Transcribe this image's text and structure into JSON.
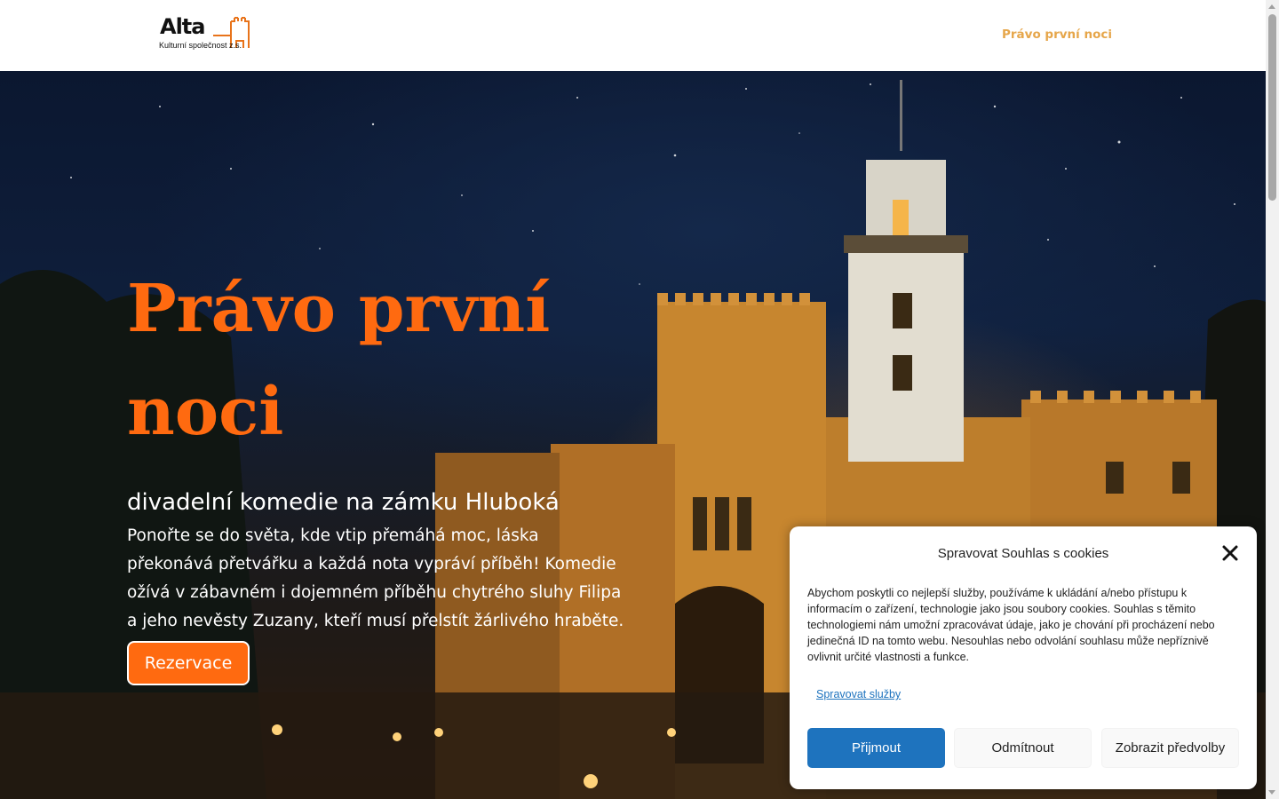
{
  "header": {
    "logo": {
      "name": "Alta",
      "tagline": "Kulturní společnost z.s."
    },
    "nav": {
      "item_label": "Právo první noci"
    }
  },
  "hero": {
    "title_line1": "Právo první",
    "title_line2": "noci",
    "subtitle": "divadelní komedie na zámku Hluboká",
    "description": "Ponořte se do světa, kde vtip přemáhá moc, láska překonává přetvářku a každá nota vypráví příběh! Komedie ožívá v zábavném i dojemném příběhu chytrého sluhy Filipa a jeho nevěsty Zuzany, kteří musí přelstít žárlivého hraběte.",
    "cta_label": "Rezervace"
  },
  "cookie_dialog": {
    "title": "Spravovat Souhlas s cookies",
    "body": "Abychom poskytli co nejlepší služby, používáme k ukládání a/nebo přístupu k informacím o zařízení, technologie jako jsou soubory cookies. Souhlas s těmito technologiemi nám umožní zpracovávat údaje, jako je chování při procházení nebo jedinečná ID na tomto webu. Nesouhlas nebo odvolání souhlasu může nepříznivě ovlivnit určité vlastnosti a funkce.",
    "manage_link": "Spravovat služby",
    "accept_label": "Přijmout",
    "deny_label": "Odmítnout",
    "preferences_label": "Zobrazit předvolby"
  },
  "colors": {
    "brand_orange": "#ff6a10",
    "nav_gold": "#e6a64a",
    "accept_blue": "#1e73be"
  }
}
